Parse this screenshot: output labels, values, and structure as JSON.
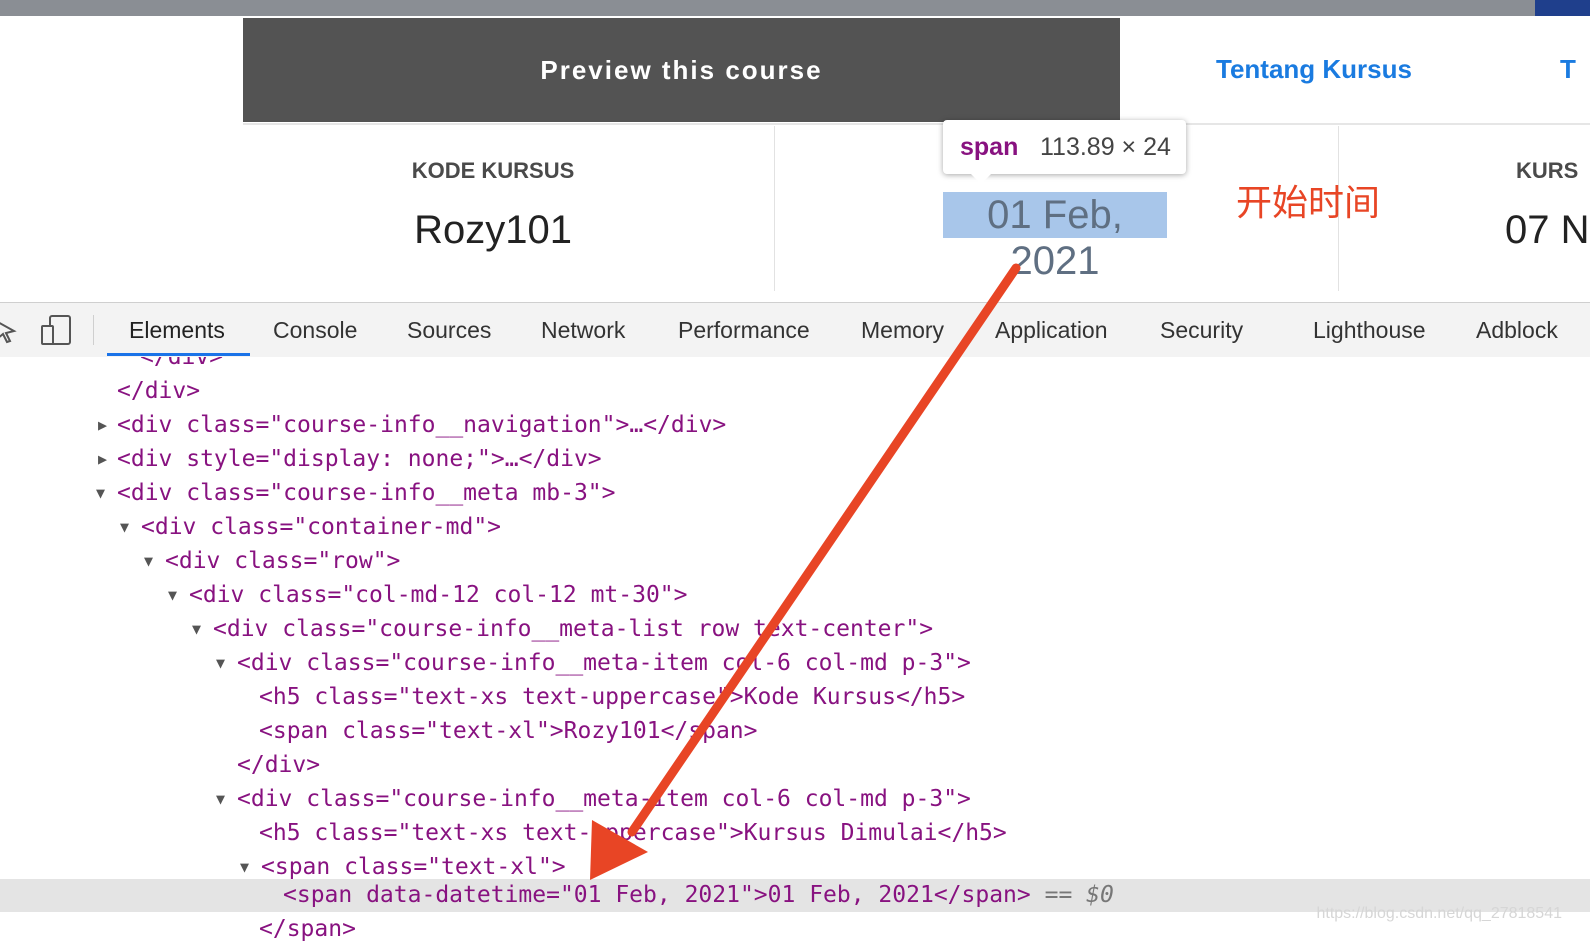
{
  "page": {
    "preview_button": "Preview this course",
    "tab_about": "Tentang Kursus",
    "tab_next_fragment": "T",
    "meta": [
      {
        "label": "KODE KURSUS",
        "value": "Rozy101"
      },
      {
        "label": "",
        "value": "01 Feb, 2021"
      },
      {
        "label": "KURS",
        "value": "07 N"
      }
    ],
    "tooltip": {
      "tag": "span",
      "dims": "113.89 × 24"
    },
    "annotation": "开始时间"
  },
  "devtools": {
    "tabs": [
      "Elements",
      "Console",
      "Sources",
      "Network",
      "Performance",
      "Memory",
      "Application",
      "Security",
      "Lighthouse",
      "Adblock"
    ],
    "active_tab": "Elements",
    "code_lines": [
      "</div>",
      "</div>",
      "<div class=\"course-info__navigation\">…</div>",
      "<div style=\"display: none;\">…</div>",
      "<div class=\"course-info__meta mb-3\">",
      "<div class=\"container-md\">",
      "<div class=\"row\">",
      "<div class=\"col-md-12 col-12 mt-30\">",
      "<div class=\"course-info__meta-list row text-center\">",
      "<div class=\"course-info__meta-item col-6 col-md p-3\">",
      "<h5 class=\"text-xs text-uppercase\">Kode Kursus</h5>",
      "<span class=\"text-xl\">Rozy101</span>",
      "</div>",
      "<div class=\"course-info__meta-item col-6 col-md p-3\">",
      "<h5 class=\"text-xs text-uppercase\">Kursus Dimulai</h5>",
      "<span class=\"text-xl\">",
      "<span data-datetime=\"01 Feb, 2021\">01 Feb, 2021</span>",
      "</span>"
    ],
    "selected_suffix": "== $0"
  },
  "watermark": "https://blog.csdn.net/qq_27818541",
  "colors": {
    "annotation_arrow": "#e84525",
    "selection": "#a8c6ea",
    "tab_link": "#1a7be0"
  },
  "icons": [
    "inspect-icon",
    "device-toggle-icon"
  ]
}
